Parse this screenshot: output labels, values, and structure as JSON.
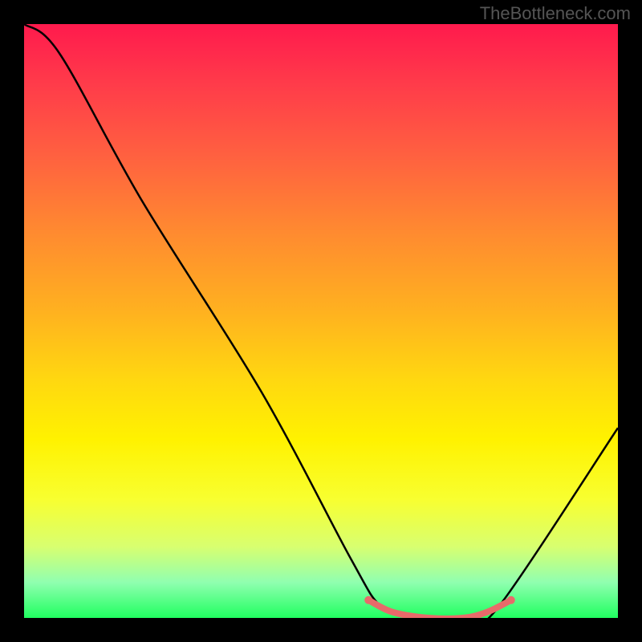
{
  "watermark": "TheBottleneck.com",
  "chart_data": {
    "type": "line",
    "title": "",
    "xlabel": "",
    "ylabel": "",
    "xlim": [
      0,
      100
    ],
    "ylim": [
      0,
      100
    ],
    "series": [
      {
        "name": "bottleneck-curve",
        "x": [
          0,
          6,
          20,
          40,
          55,
          60,
          65,
          70,
          75,
          80,
          100
        ],
        "y": [
          100,
          95,
          70,
          38,
          10,
          2,
          0,
          0,
          0,
          2,
          32
        ],
        "color": "#000000"
      }
    ],
    "highlight_segment": {
      "name": "optimal-range",
      "x": [
        58,
        62,
        68,
        74,
        78,
        82
      ],
      "y": [
        3,
        1,
        0,
        0,
        1,
        3
      ],
      "color": "#e86a6a"
    },
    "gradient_stops": [
      {
        "pos": 0,
        "color": "#ff1a4d"
      },
      {
        "pos": 22,
        "color": "#ff6040"
      },
      {
        "pos": 48,
        "color": "#ffb020"
      },
      {
        "pos": 70,
        "color": "#fff200"
      },
      {
        "pos": 88,
        "color": "#d8ff70"
      },
      {
        "pos": 100,
        "color": "#20ff60"
      }
    ]
  }
}
